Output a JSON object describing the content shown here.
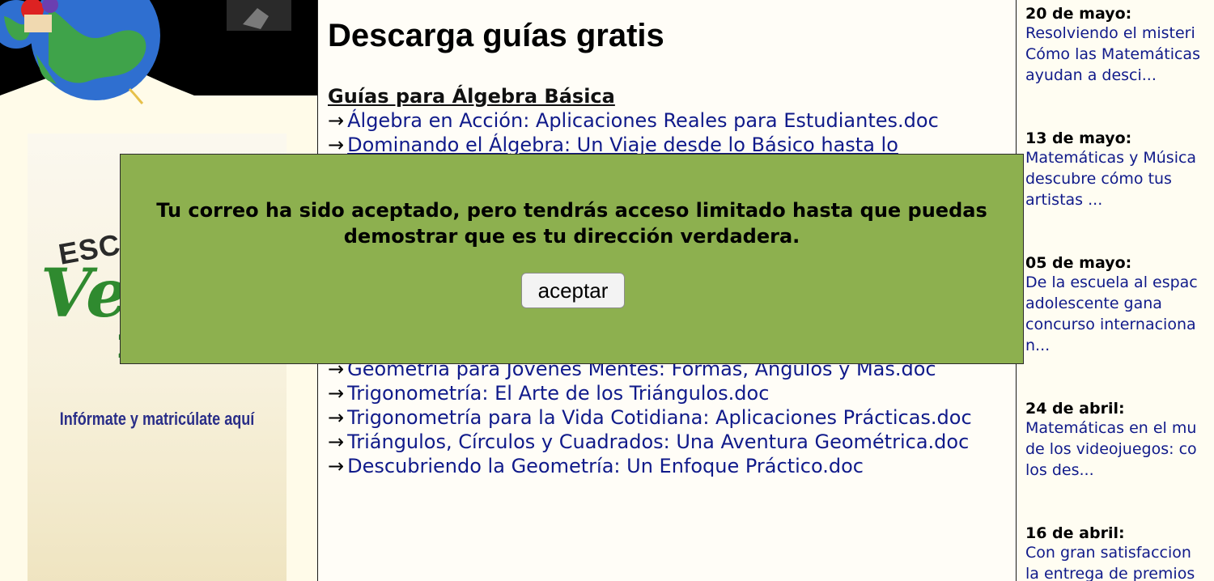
{
  "main": {
    "title": "Descarga guías gratis",
    "section_heading": "Guías para Álgebra Básica",
    "arrow": "→",
    "guides_top": [
      "Álgebra en Acción: Aplicaciones Reales para Estudiantes.doc",
      "Dominando el Álgebra: Un Viaje desde lo Básico hasta lo"
    ],
    "guides_bottom": [
      "Geometría para Jóvenes Mentes: Formas, Ángulos y Más.doc",
      "Trigonometría: El Arte de los Triángulos.doc",
      "Trigonometría para la Vida Cotidiana: Aplicaciones Prácticas.doc",
      "Triángulos, Círculos y Cuadrados: Una Aventura Geométrica.doc",
      "Descubriendo la Geometría: Un Enfoque Práctico.doc"
    ]
  },
  "sidebar_left": {
    "promo_brand_top": "ESCU",
    "promo_brand_script": "Ve",
    "promo_brand_year": "2",
    "promo_link": "Infórmate y matricúlate aquí"
  },
  "news": [
    {
      "date": "20 de mayo:",
      "text": "Resolviendo el misteri\nCómo las Matemáticas\nayudan a desci..."
    },
    {
      "date": "13 de mayo:",
      "text": "Matemáticas y Música\ndescubre cómo tus\nartistas ..."
    },
    {
      "date": "05 de mayo:",
      "text": "De la escuela al espac\nadolescente gana\nconcurso internaciona\nn..."
    },
    {
      "date": "24 de abril:",
      "text": "Matemáticas en el mu\nde los videojuegos: co\nlos des..."
    },
    {
      "date": "16 de abril:",
      "text": "Con gran satisfaccion\nla entrega de premios"
    }
  ],
  "modal": {
    "message": "Tu correo ha sido aceptado, pero tendrás acceso limitado hasta que puedas demostrar que es tu dirección verdadera.",
    "button_label": "aceptar",
    "background": "#8db04f"
  },
  "colors": {
    "link": "#101a8a",
    "promo_link": "#2a2e88"
  }
}
